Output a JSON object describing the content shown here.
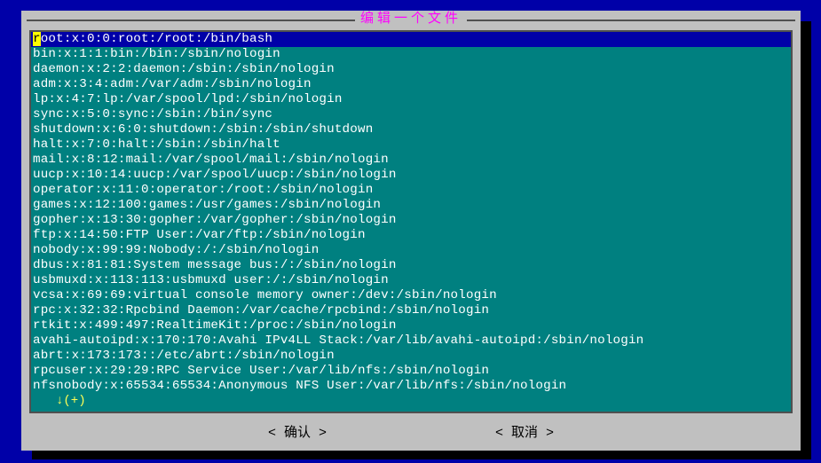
{
  "title": "编辑一个文件",
  "status": "↓(+)",
  "buttons": {
    "ok": "< 确认 >",
    "cancel": "< 取消 >"
  },
  "lines": [
    "root:x:0:0:root:/root:/bin/bash",
    "bin:x:1:1:bin:/bin:/sbin/nologin",
    "daemon:x:2:2:daemon:/sbin:/sbin/nologin",
    "adm:x:3:4:adm:/var/adm:/sbin/nologin",
    "lp:x:4:7:lp:/var/spool/lpd:/sbin/nologin",
    "sync:x:5:0:sync:/sbin:/bin/sync",
    "shutdown:x:6:0:shutdown:/sbin:/sbin/shutdown",
    "halt:x:7:0:halt:/sbin:/sbin/halt",
    "mail:x:8:12:mail:/var/spool/mail:/sbin/nologin",
    "uucp:x:10:14:uucp:/var/spool/uucp:/sbin/nologin",
    "operator:x:11:0:operator:/root:/sbin/nologin",
    "games:x:12:100:games:/usr/games:/sbin/nologin",
    "gopher:x:13:30:gopher:/var/gopher:/sbin/nologin",
    "ftp:x:14:50:FTP User:/var/ftp:/sbin/nologin",
    "nobody:x:99:99:Nobody:/:/sbin/nologin",
    "dbus:x:81:81:System message bus:/:/sbin/nologin",
    "usbmuxd:x:113:113:usbmuxd user:/:/sbin/nologin",
    "vcsa:x:69:69:virtual console memory owner:/dev:/sbin/nologin",
    "rpc:x:32:32:Rpcbind Daemon:/var/cache/rpcbind:/sbin/nologin",
    "rtkit:x:499:497:RealtimeKit:/proc:/sbin/nologin",
    "avahi-autoipd:x:170:170:Avahi IPv4LL Stack:/var/lib/avahi-autoipd:/sbin/nologin",
    "abrt:x:173:173::/etc/abrt:/sbin/nologin",
    "rpcuser:x:29:29:RPC Service User:/var/lib/nfs:/sbin/nologin",
    "nfsnobody:x:65534:65534:Anonymous NFS User:/var/lib/nfs:/sbin/nologin"
  ]
}
